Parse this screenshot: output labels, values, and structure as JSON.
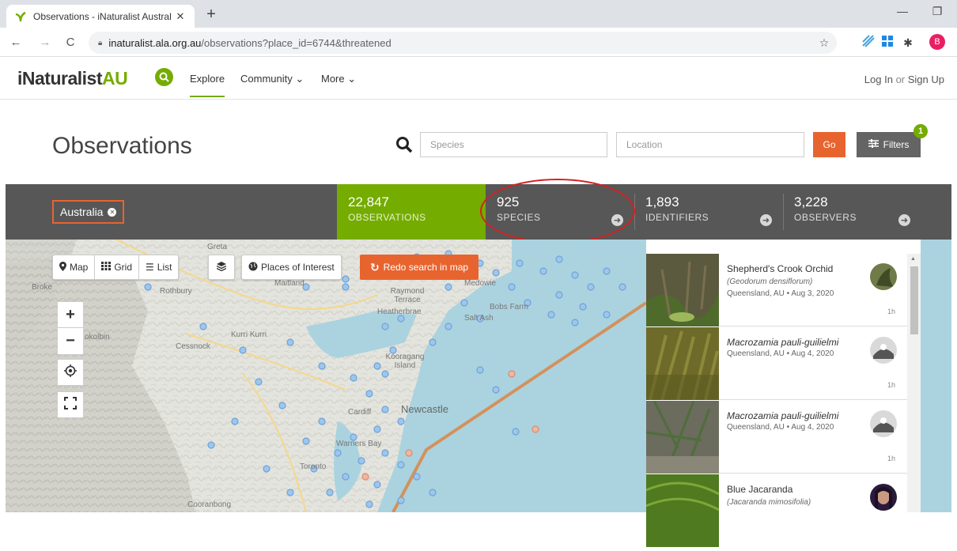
{
  "browser": {
    "tab_title": "Observations - iNaturalist Austral",
    "new_tab": "+",
    "url_host": "inaturalist.ala.org.au",
    "url_path": "/observations?place_id=6744&threatened",
    "profile_letter": "B"
  },
  "header": {
    "logo_i": "iNaturalist",
    "logo_au": "AU",
    "menu": {
      "explore": "Explore",
      "community": "Community ⌄",
      "more": "More ⌄"
    },
    "login": "Log In",
    "or": " or ",
    "signup": "Sign Up"
  },
  "page": {
    "title": "Observations",
    "species_placeholder": "Species",
    "location_placeholder": "Location",
    "go": "Go",
    "filters": "Filters",
    "filters_count": "1"
  },
  "stats": {
    "place": "Australia",
    "observations": {
      "value": "22,847",
      "label": "OBSERVATIONS"
    },
    "species": {
      "value": "925",
      "label": "SPECIES"
    },
    "identifiers": {
      "value": "1,893",
      "label": "IDENTIFIERS"
    },
    "observers": {
      "value": "3,228",
      "label": "OBSERVERS"
    }
  },
  "map": {
    "views": {
      "map": "Map",
      "grid": "Grid",
      "list": "List"
    },
    "places_of_interest": "Places of Interest",
    "redo_search": "Redo search in map",
    "labels": {
      "greta": "Greta",
      "rothbury": "Rothbury",
      "maitland": "Maitland",
      "broke": "Broke",
      "kurri_kurri": "Kurri Kurri",
      "cessnock": "Cessnock",
      "pokolbin": "okolbin",
      "raymond_terrace": "Raymond Terrace",
      "heatherbrae": "Heatherbrae",
      "medowie": "Medowie",
      "bobs_farm": "Bobs Farm",
      "salt_ash": "Salt Ash",
      "kooragang_island": "Kooragang Island",
      "newcastle": "Newcastle",
      "cardiff": "Cardiff",
      "warners_bay": "Warners Bay",
      "toronto": "Toronto",
      "cooranbong": "Cooranbong"
    }
  },
  "observations": [
    {
      "common": "Shepherd's Crook Orchid",
      "scientific": "(Geodorum densiflorum)",
      "meta": "Queensland, AU • Aug 3, 2020",
      "ago": "1h"
    },
    {
      "common": "Macrozamia pauli-guilielmi",
      "scientific": "",
      "meta": "Queensland, AU • Aug 4, 2020",
      "ago": "1h"
    },
    {
      "common": "Macrozamia pauli-guilielmi",
      "scientific": "",
      "meta": "Queensland, AU • Aug 4, 2020",
      "ago": "1h"
    },
    {
      "common": "Blue Jacaranda",
      "scientific": "(Jacaranda mimosifolia)",
      "meta": "",
      "ago": ""
    }
  ]
}
